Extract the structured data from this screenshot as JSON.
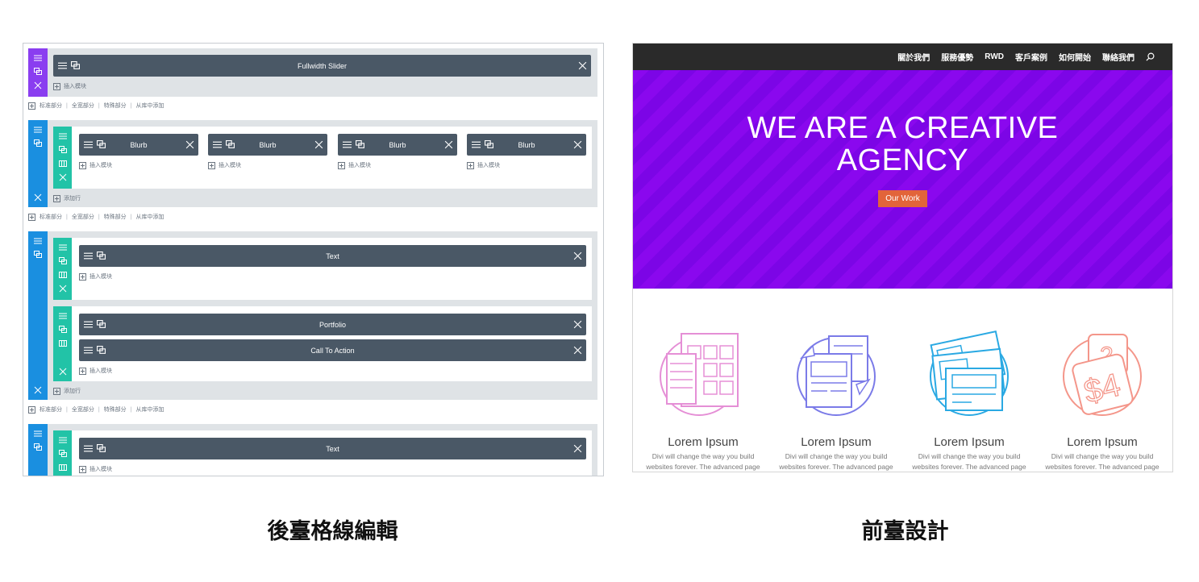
{
  "builder": {
    "sections": [
      {
        "rows": [
          {
            "modules": [
              {
                "label": "Fullwidth Slider"
              }
            ],
            "insert_label": "插入模块"
          }
        ]
      },
      {
        "rows": [
          {
            "modules": [
              {
                "label": "Blurb"
              },
              {
                "label": "Blurb"
              },
              {
                "label": "Blurb"
              },
              {
                "label": "Blurb"
              }
            ],
            "insert_label": "插入模块"
          }
        ],
        "add_row_label": "添加行"
      },
      {
        "rows": [
          {
            "modules": [
              {
                "label": "Text"
              }
            ],
            "insert_label": "插入模块"
          },
          {
            "modules": [
              {
                "label": "Portfolio"
              },
              {
                "label": "Call To Action"
              }
            ],
            "insert_label": "插入模块"
          }
        ],
        "add_row_label": "添加行"
      },
      {
        "rows": [
          {
            "modules": [
              {
                "label": "Text"
              }
            ],
            "insert_label": "插入模块"
          }
        ]
      }
    ],
    "add_links": [
      "标准部分",
      "全宽部分",
      "特殊部分",
      "从库中添加"
    ],
    "caption": "後臺格線編輯"
  },
  "frontend": {
    "nav": [
      "關於我們",
      "服務優勢",
      "RWD",
      "客戶案例",
      "如何開始",
      "聯絡我們"
    ],
    "search_icon": "search-icon",
    "hero": {
      "title_line1": "WE ARE A CREATIVE",
      "title_line2": "AGENCY",
      "button": "Our Work",
      "colors": {
        "bg": "#8a08ee",
        "button": "#e2643a"
      }
    },
    "features": [
      {
        "title": "Lorem Ipsum",
        "text": "Divi will change the way you build websites forever. The advanced page builder makes it possible to",
        "icon": "tablet-grid-icon",
        "color": "#e58fd6"
      },
      {
        "title": "Lorem Ipsum",
        "text": "Divi will change the way you build websites forever. The advanced page builder makes it possible to",
        "icon": "sync-devices-icon",
        "color": "#7b7be8"
      },
      {
        "title": "Lorem Ipsum",
        "text": "Divi will change the way you build websites forever. The advanced page builder makes it possible to",
        "icon": "layouts-icon",
        "color": "#2aa9e3"
      },
      {
        "title": "Lorem Ipsum",
        "text": "Divi will change the way you build websites forever. The advanced page builder makes it possible to",
        "icon": "price-tag-icon",
        "color": "#f4968a"
      }
    ],
    "caption": "前臺設計"
  }
}
